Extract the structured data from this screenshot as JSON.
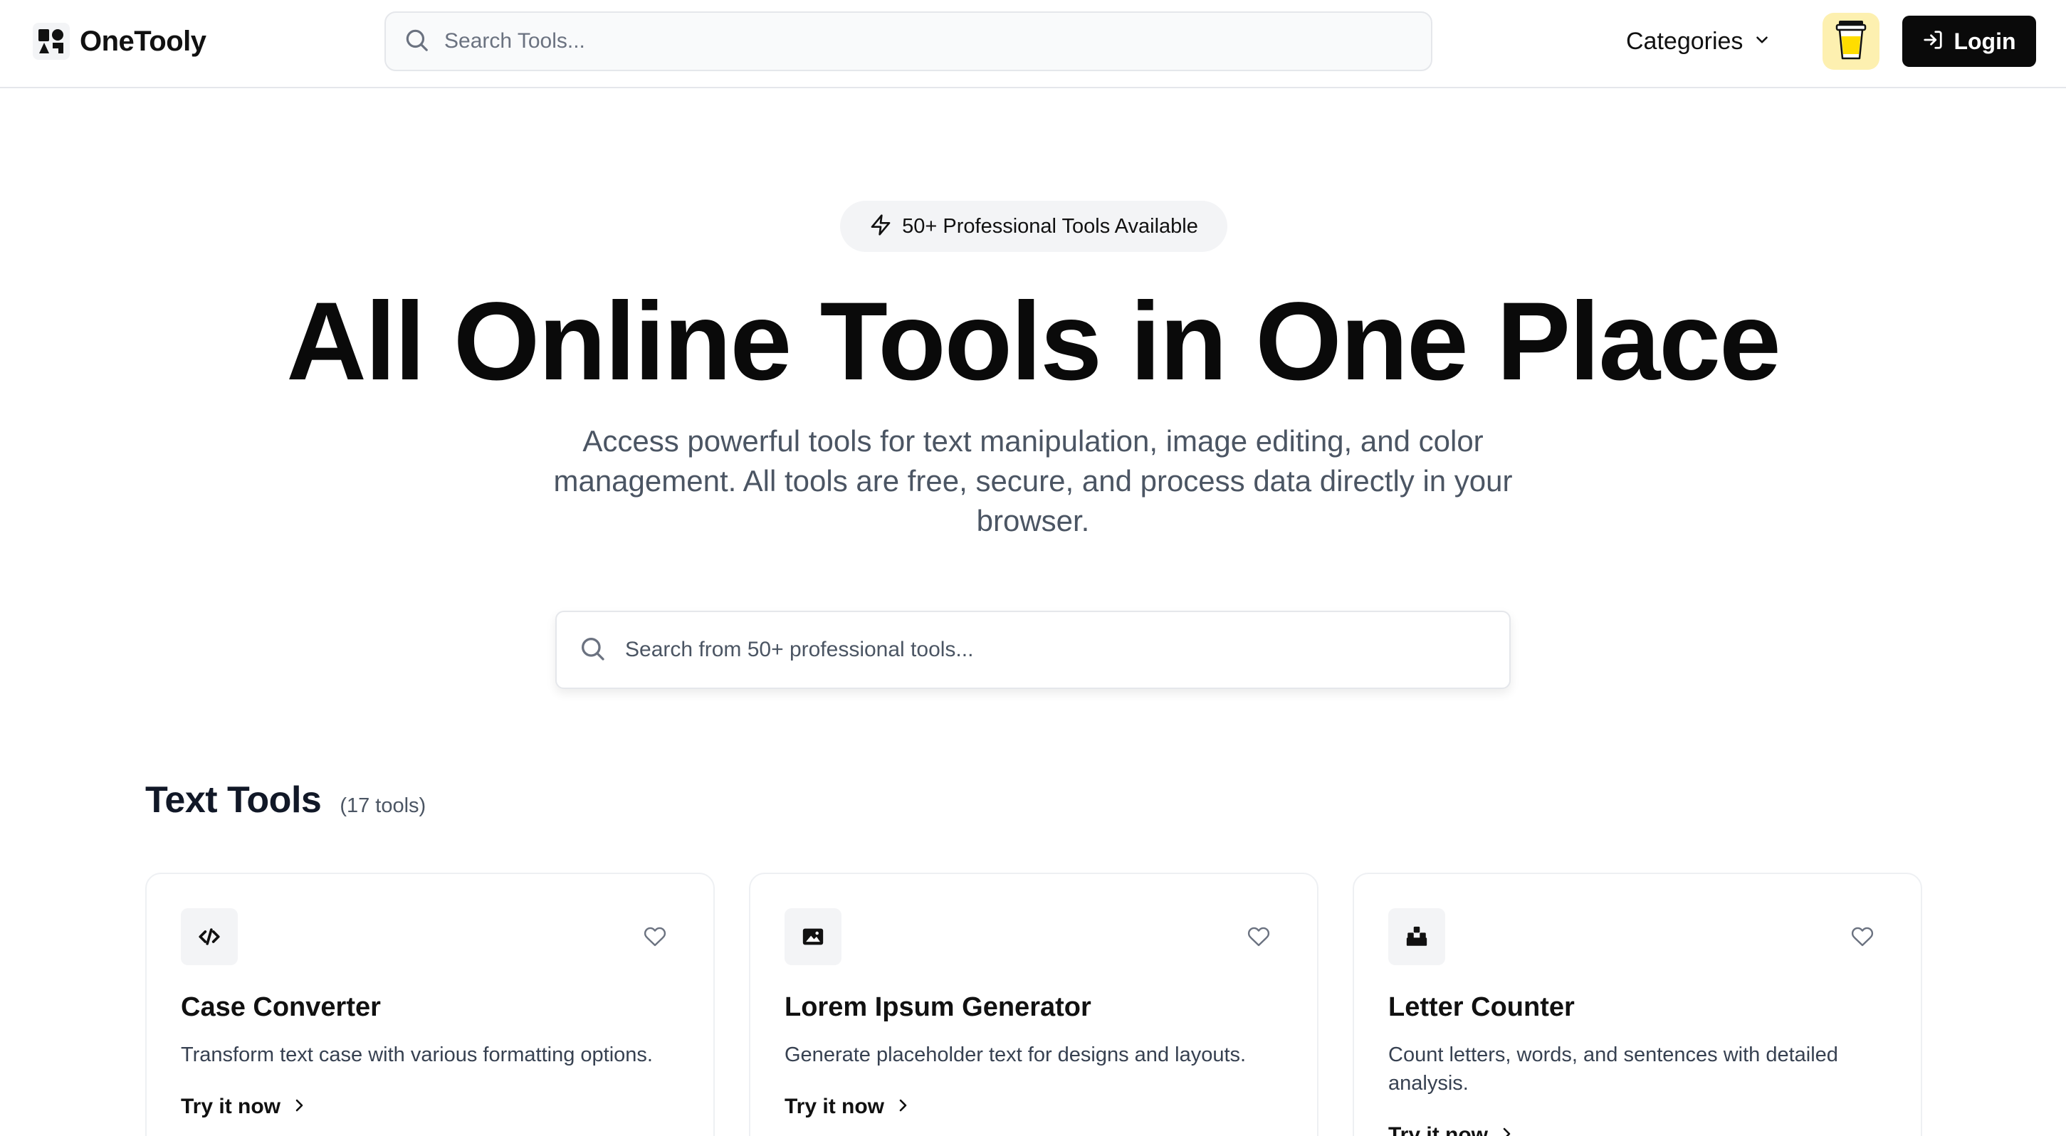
{
  "header": {
    "brand": "OneTooly",
    "search_placeholder": "Search Tools...",
    "categories_label": "Categories",
    "login_label": "Login"
  },
  "hero": {
    "badge": "50+ Professional Tools Available",
    "title": "All Online Tools in One Place",
    "subtitle": "Access powerful tools for text manipulation, image editing, and color management. All tools are free, secure, and process data directly in your browser.",
    "search_placeholder": "Search from 50+ professional tools..."
  },
  "section": {
    "title": "Text Tools",
    "count": "(17 tools)"
  },
  "cards": [
    {
      "icon": "code-icon",
      "title": "Case Converter",
      "description": "Transform text case with various formatting options.",
      "link": "Try it now"
    },
    {
      "icon": "image-icon",
      "title": "Lorem Ipsum Generator",
      "description": "Generate placeholder text for designs and layouts.",
      "link": "Try it now"
    },
    {
      "icon": "blocks-icon",
      "title": "Letter Counter",
      "description": "Count letters, words, and sentences with detailed analysis.",
      "link": "Try it now"
    }
  ],
  "colors": {
    "accent_dark": "#0a0a0a",
    "coffee_bg": "#fdf0b0",
    "muted_text": "#4b5563",
    "border": "#e5e7eb"
  }
}
